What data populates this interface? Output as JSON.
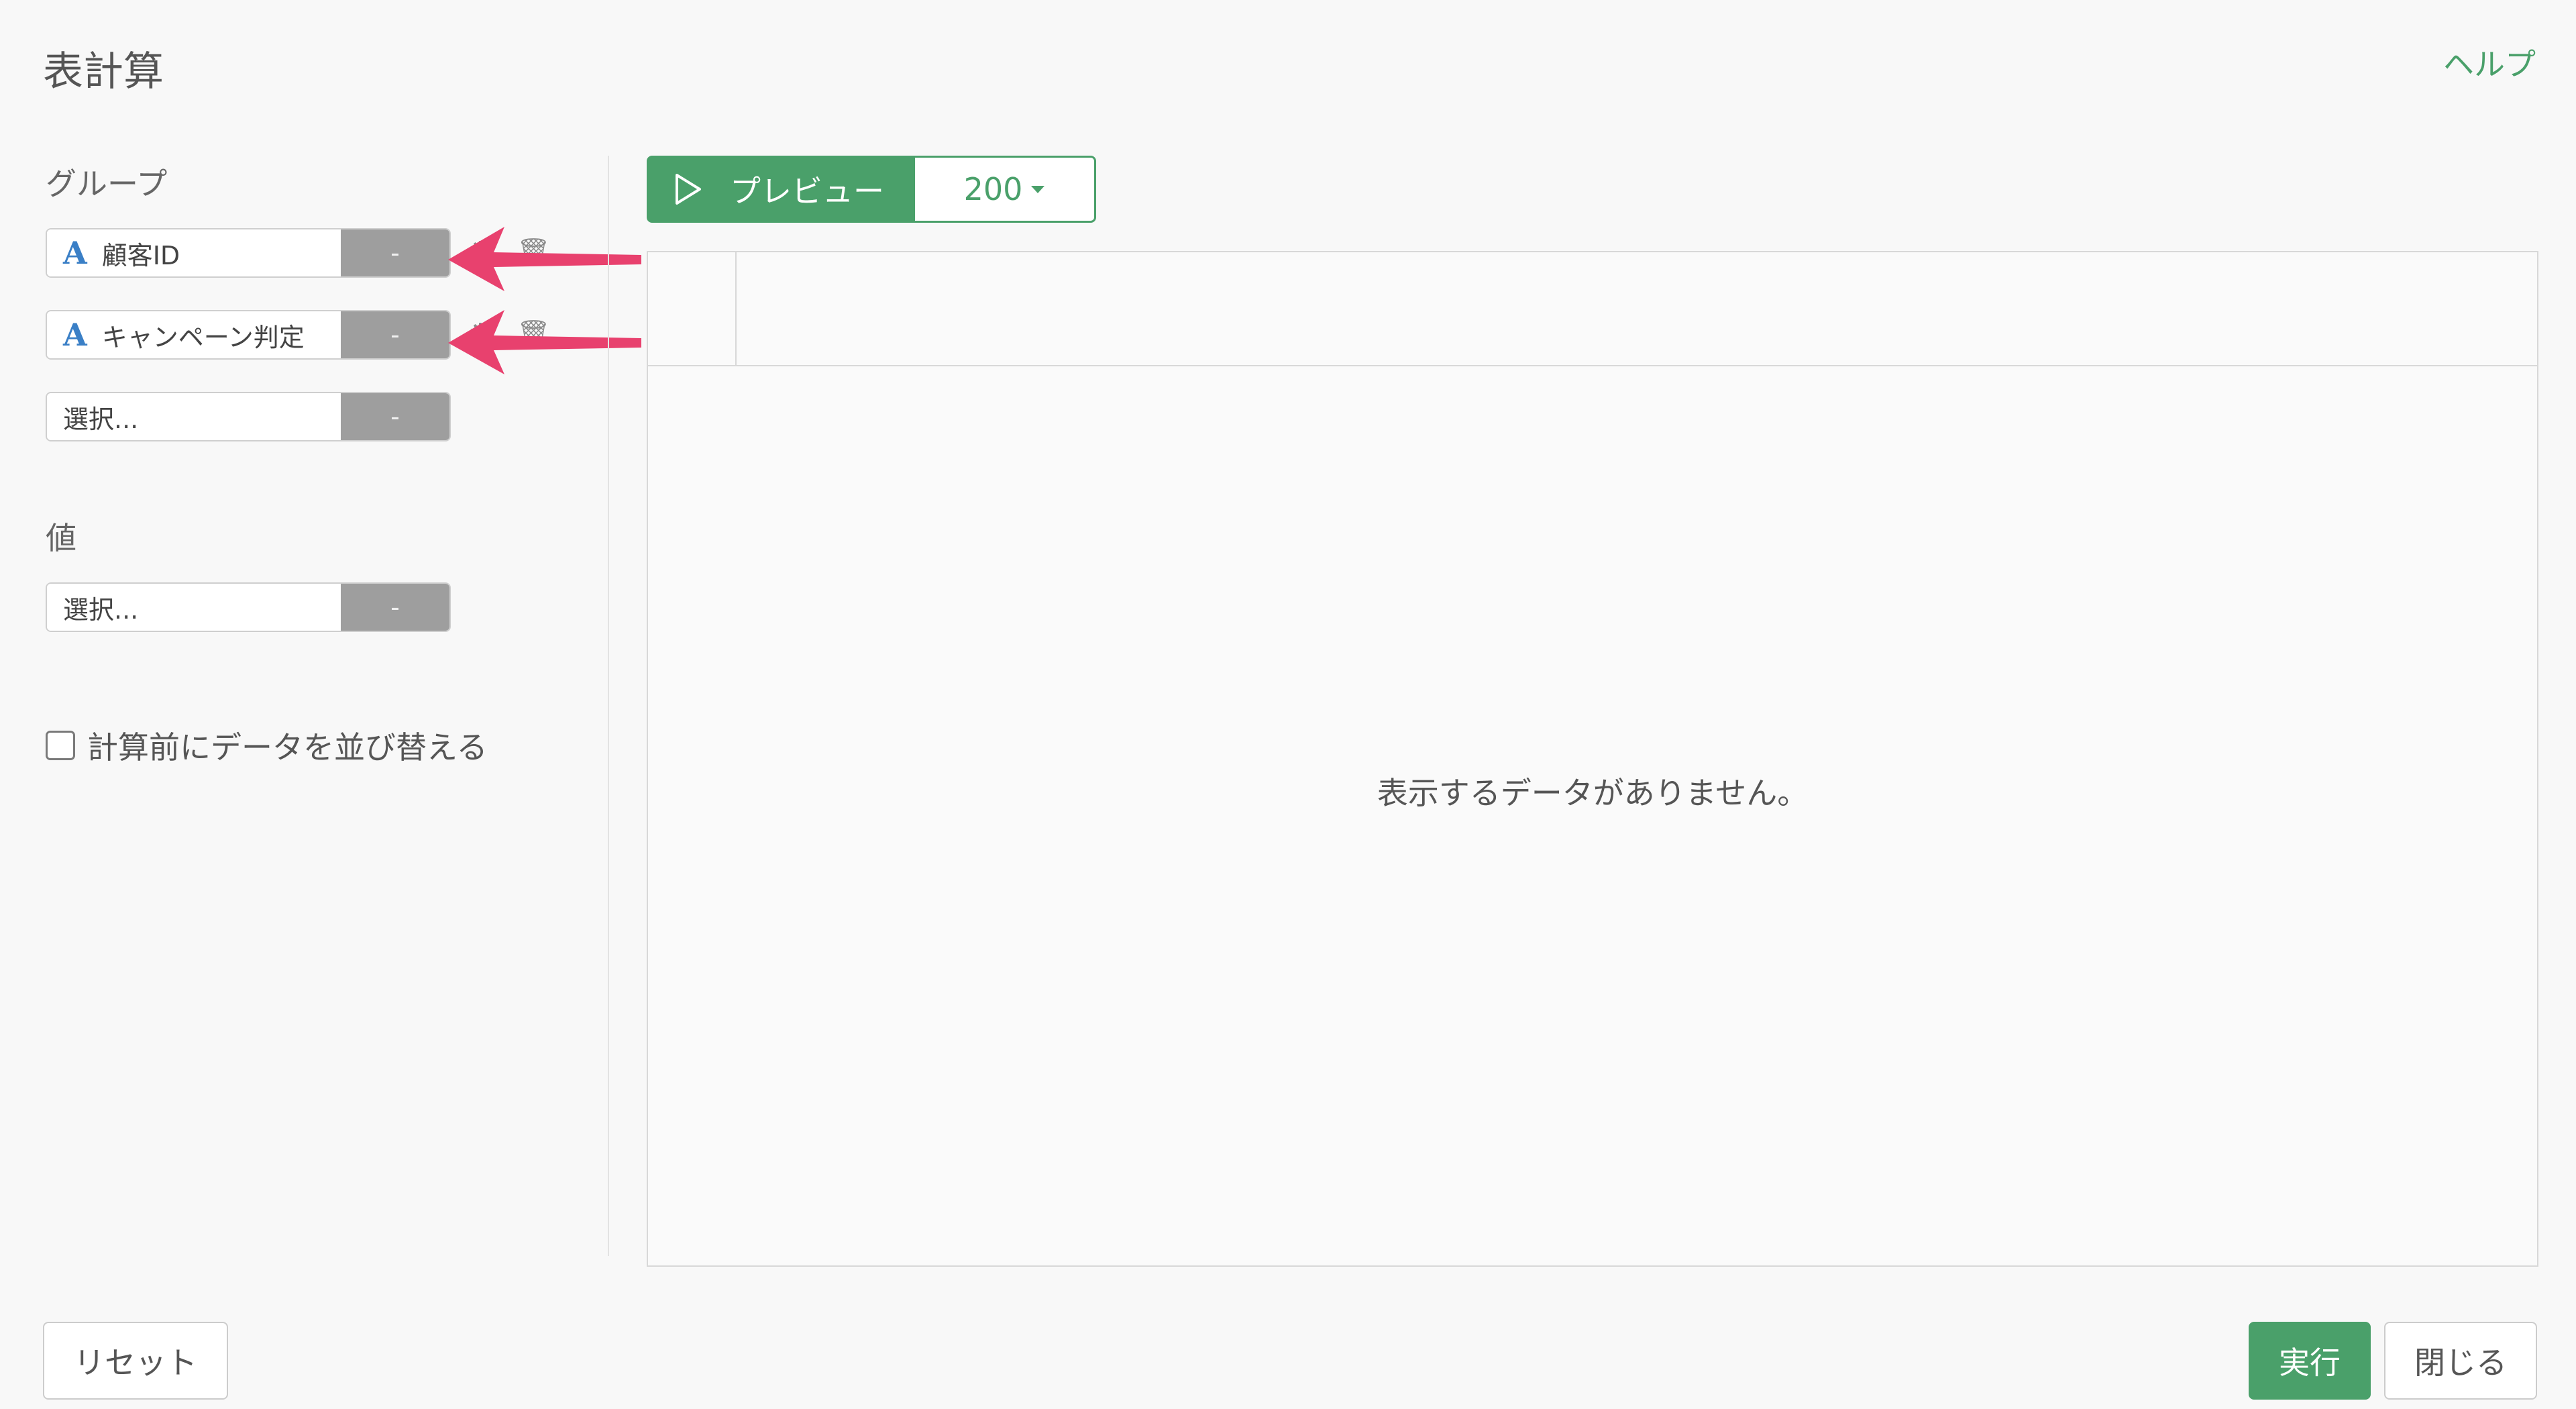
{
  "dialog": {
    "title": "表計算",
    "help_link": "ヘルプ"
  },
  "group_section": {
    "label": "グループ",
    "fields": [
      {
        "type_icon": "A",
        "name": "顧客ID",
        "modifier": "-"
      },
      {
        "type_icon": "A",
        "name": "キャンペーン判定",
        "modifier": "-"
      },
      {
        "name": "選択...",
        "modifier": "-"
      }
    ]
  },
  "value_section": {
    "label": "値",
    "fields": [
      {
        "name": "選択...",
        "modifier": "-"
      }
    ]
  },
  "sort_option": {
    "label": "計算前にデータを並び替える",
    "checked": false
  },
  "preview": {
    "button_label": "プレビュー",
    "row_limit": "200",
    "empty_message": "表示するデータがありません。"
  },
  "footer": {
    "reset_label": "リセット",
    "run_label": "実行",
    "close_label": "閉じる"
  },
  "colors": {
    "accent_green": "#4aa06a",
    "type_icon_blue": "#3a7fc6",
    "annotation_arrow": "#e8416e",
    "modifier_gray": "#9e9e9e"
  }
}
